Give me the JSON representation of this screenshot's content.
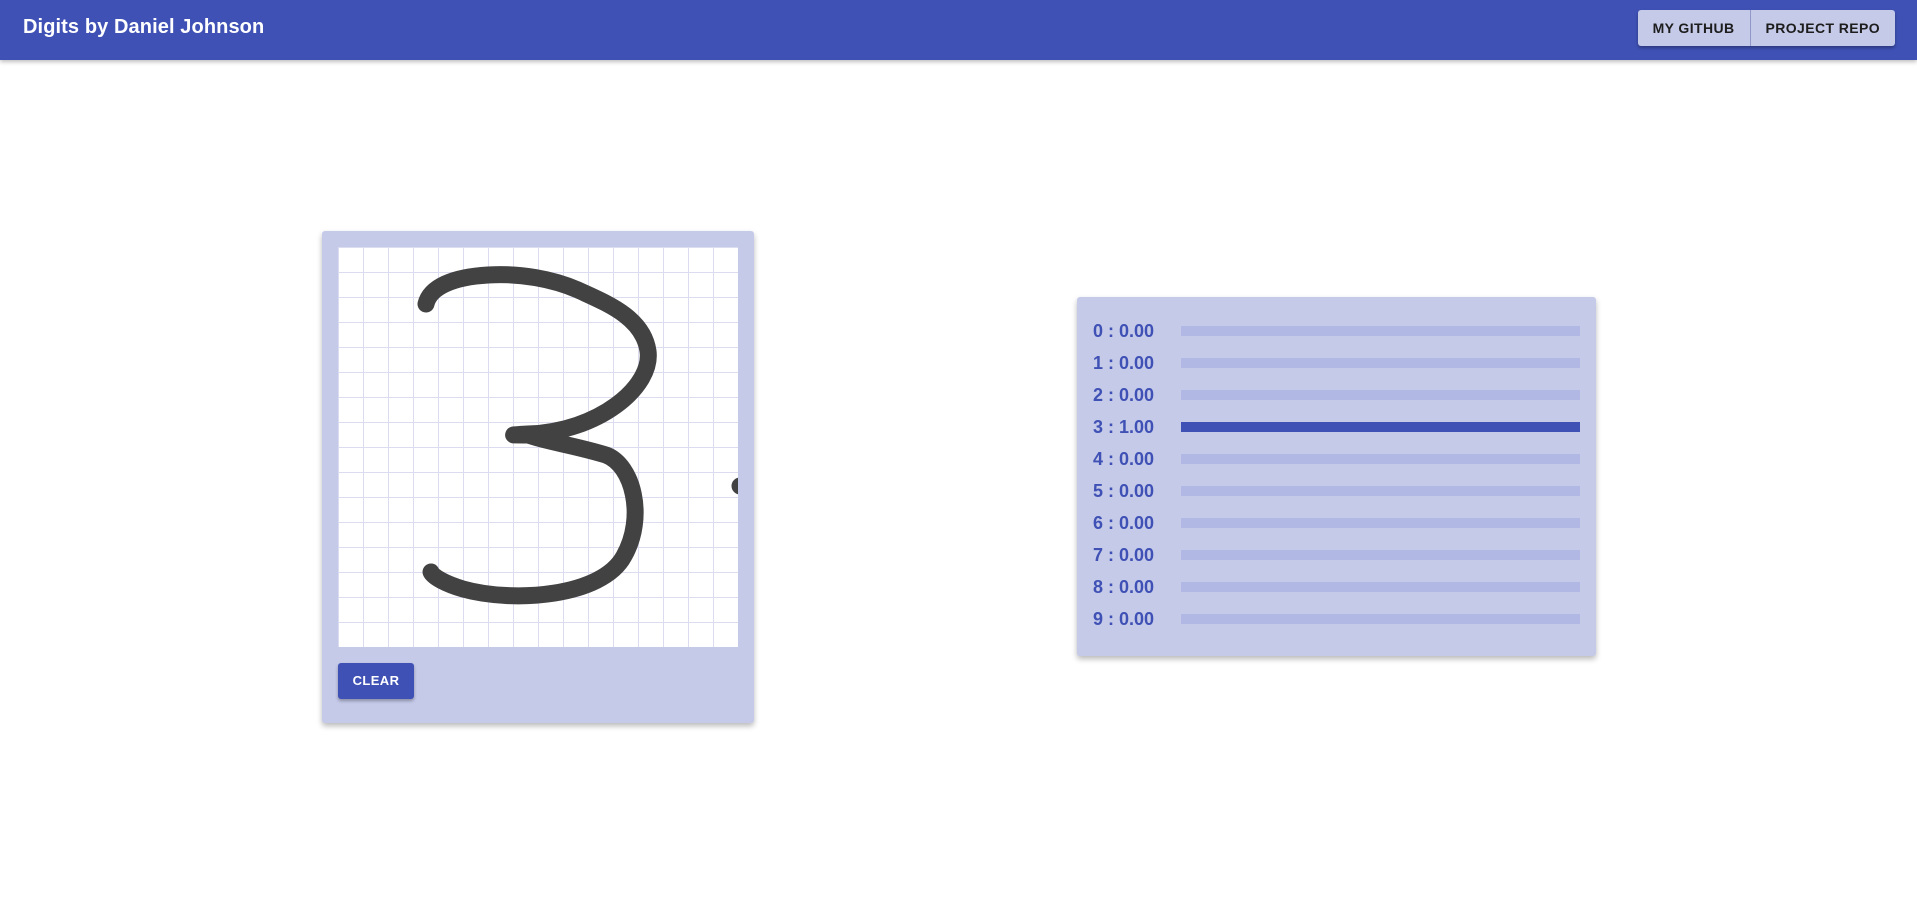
{
  "appbar": {
    "title": "Digits by Daniel Johnson",
    "buttons": [
      {
        "label": "MY GITHUB"
      },
      {
        "label": "PROJECT REPO"
      }
    ]
  },
  "drawing_panel": {
    "drawn_digit": "3",
    "clear_label": "CLEAR"
  },
  "predictions": [
    {
      "digit": "0",
      "probability": 0.0,
      "label": "0 : 0.00"
    },
    {
      "digit": "1",
      "probability": 0.0,
      "label": "1 : 0.00"
    },
    {
      "digit": "2",
      "probability": 0.0,
      "label": "2 : 0.00"
    },
    {
      "digit": "3",
      "probability": 1.0,
      "label": "3 : 1.00"
    },
    {
      "digit": "4",
      "probability": 0.0,
      "label": "4 : 0.00"
    },
    {
      "digit": "5",
      "probability": 0.0,
      "label": "5 : 0.00"
    },
    {
      "digit": "6",
      "probability": 0.0,
      "label": "6 : 0.00"
    },
    {
      "digit": "7",
      "probability": 0.0,
      "label": "7 : 0.00"
    },
    {
      "digit": "8",
      "probability": 0.0,
      "label": "8 : 0.00"
    },
    {
      "digit": "9",
      "probability": 0.0,
      "label": "9 : 0.00"
    }
  ],
  "colors": {
    "primary": "#3f51b5",
    "panel": "#c5cae9",
    "bar_track": "#b0b8e3",
    "stroke": "#424242"
  }
}
